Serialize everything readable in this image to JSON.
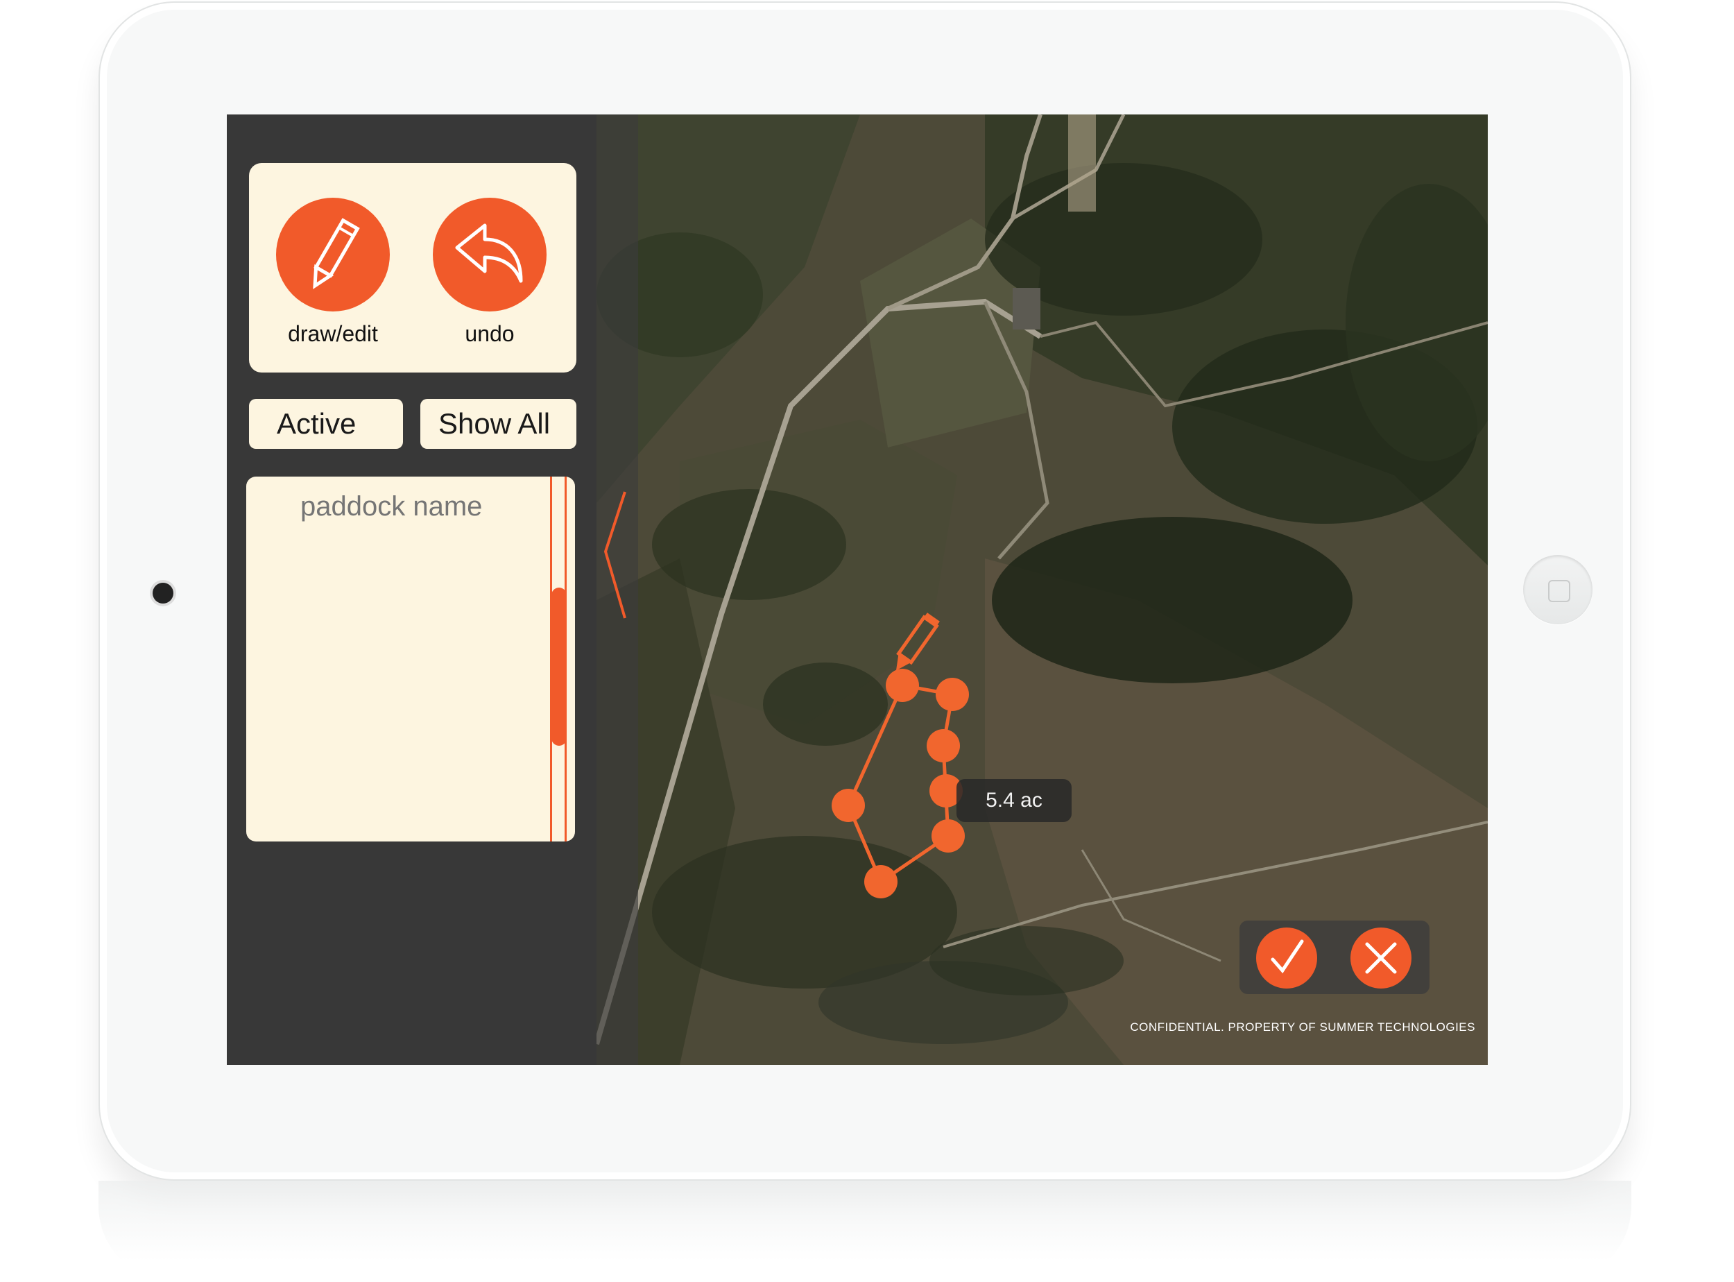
{
  "sidebar": {
    "tools": [
      {
        "label": "draw/edit",
        "icon": "pencil-icon"
      },
      {
        "label": "undo",
        "icon": "undo-arrow-icon"
      }
    ],
    "toggles": {
      "active_label": "Active",
      "show_all_label": "Show All"
    },
    "paddock_name_placeholder": "paddock name",
    "collapse_icon": "chevron-left-icon"
  },
  "map": {
    "area_label": "5.4 ac",
    "vertex_count": 7,
    "drawing_icon": "pencil-icon",
    "confirm_icon": "checkmark-icon",
    "cancel_icon": "close-icon",
    "footer": "CONFIDENTIAL. PROPERTY OF SUMMER TECHNOLOGIES"
  },
  "colors": {
    "accent": "#f15a2a",
    "panel": "#fdf5e0",
    "sidebar": "#383838"
  }
}
